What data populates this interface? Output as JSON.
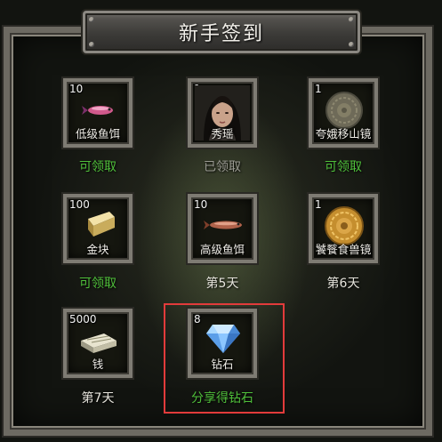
{
  "dialog": {
    "title": "新手签到"
  },
  "rewards": [
    {
      "count": "10",
      "name": "低级鱼饵",
      "status": "可领取",
      "icon": "fish-bait-low-icon"
    },
    {
      "count": "1",
      "name": "秀瑶",
      "status": "已领取",
      "icon": "character-portrait-icon"
    },
    {
      "count": "1",
      "name": "夸娥移山镜",
      "status": "可领取",
      "icon": "bronze-mirror-icon"
    },
    {
      "count": "100",
      "name": "金块",
      "status": "可领取",
      "icon": "gold-bar-icon"
    },
    {
      "count": "10",
      "name": "高级鱼饵",
      "status": "第5天",
      "icon": "fish-bait-high-icon"
    },
    {
      "count": "1",
      "name": "饕餮食兽镜",
      "status": "第6天",
      "icon": "gold-mirror-icon"
    },
    {
      "count": "5000",
      "name": "钱",
      "status": "第7天",
      "icon": "money-stack-icon"
    },
    {
      "count": "8",
      "name": "钻石",
      "status": "分享得钻石",
      "icon": "diamond-icon"
    }
  ],
  "colors": {
    "claimable": "#4fbf3a",
    "claimed": "#9a9a92",
    "highlight": "#e23b3b"
  }
}
